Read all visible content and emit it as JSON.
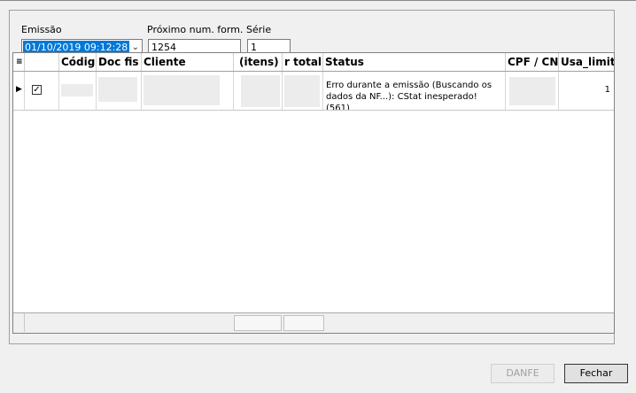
{
  "form": {
    "emissao_label": "Emissão",
    "emissao_value": "01/10/2019 09:12:28",
    "proximo_label": "Próximo num. form.",
    "proximo_value": "1254",
    "serie_label": "Série",
    "serie_value": "1"
  },
  "grid": {
    "columns": [
      "Códig",
      "Doc fis",
      "Cliente",
      "(itens)",
      "r total",
      "Status",
      "CPF / CN",
      "Usa_limit"
    ],
    "row": {
      "checked": true,
      "status_line1": "Erro durante a emissão (Buscando os",
      "status_line2": "dados da NF...): CStat inesperado! (561)",
      "usa_limit": "1"
    }
  },
  "buttons": {
    "danfe": "DANFE",
    "fechar": "Fechar"
  }
}
